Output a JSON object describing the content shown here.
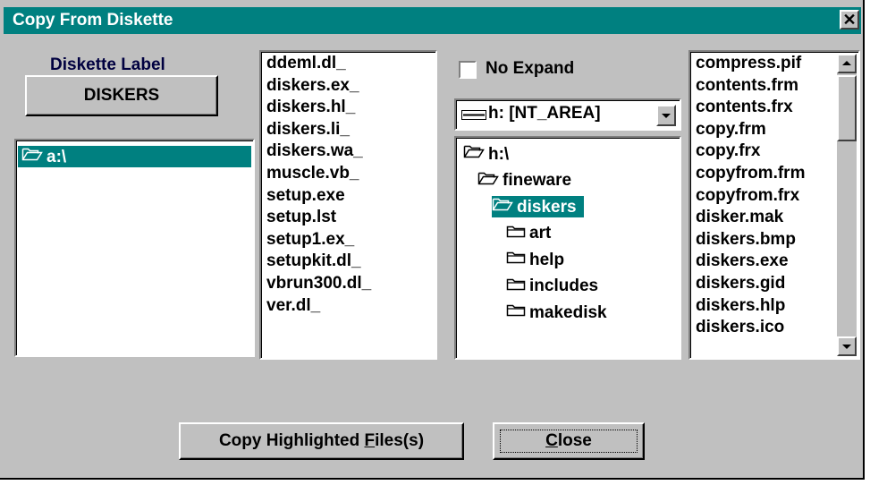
{
  "window": {
    "title": "Copy From Diskette",
    "close_glyph": "✕"
  },
  "diskette": {
    "label_caption": "Diskette Label",
    "label_button": "DISKERS"
  },
  "drive_list": {
    "items": [
      "a:\\"
    ],
    "selected": 0
  },
  "source_files": {
    "items": [
      "ddeml.dl_",
      "diskers.ex_",
      "diskers.hl_",
      "diskers.li_",
      "diskers.wa_",
      "muscle.vb_",
      "setup.exe",
      "setup.lst",
      "setup1.ex_",
      "setupkit.dl_",
      "vbrun300.dl_",
      "ver.dl_"
    ]
  },
  "no_expand": {
    "label": "No Expand",
    "checked": false
  },
  "drive_combo": {
    "value": "h: [NT_AREA]"
  },
  "dir_tree": {
    "items": [
      {
        "label": "h:\\",
        "state": "open",
        "level": 0,
        "selected": false
      },
      {
        "label": "fineware",
        "state": "open",
        "level": 1,
        "selected": false
      },
      {
        "label": "diskers",
        "state": "open",
        "level": 2,
        "selected": true
      },
      {
        "label": "art",
        "state": "closed",
        "level": 3,
        "selected": false
      },
      {
        "label": "help",
        "state": "closed",
        "level": 3,
        "selected": false
      },
      {
        "label": "includes",
        "state": "closed",
        "level": 3,
        "selected": false
      },
      {
        "label": "makedisk",
        "state": "closed",
        "level": 3,
        "selected": false
      }
    ]
  },
  "target_files": {
    "items": [
      "compress.pif",
      "contents.frm",
      "contents.frx",
      "copy.frm",
      "copy.frx",
      "copyfrom.frm",
      "copyfrom.frx",
      "disker.mak",
      "diskers.bmp",
      "diskers.exe",
      "diskers.gid",
      "diskers.hlp",
      "diskers.ico"
    ]
  },
  "buttons": {
    "copy_prefix": "Copy Highlighted ",
    "copy_mnemonic": "F",
    "copy_suffix": "iles(s)",
    "close_mnemonic": "C",
    "close_suffix": "lose"
  },
  "colors": {
    "titlebar": "#008080",
    "selection": "#008080",
    "face": "#c0c0c0"
  }
}
